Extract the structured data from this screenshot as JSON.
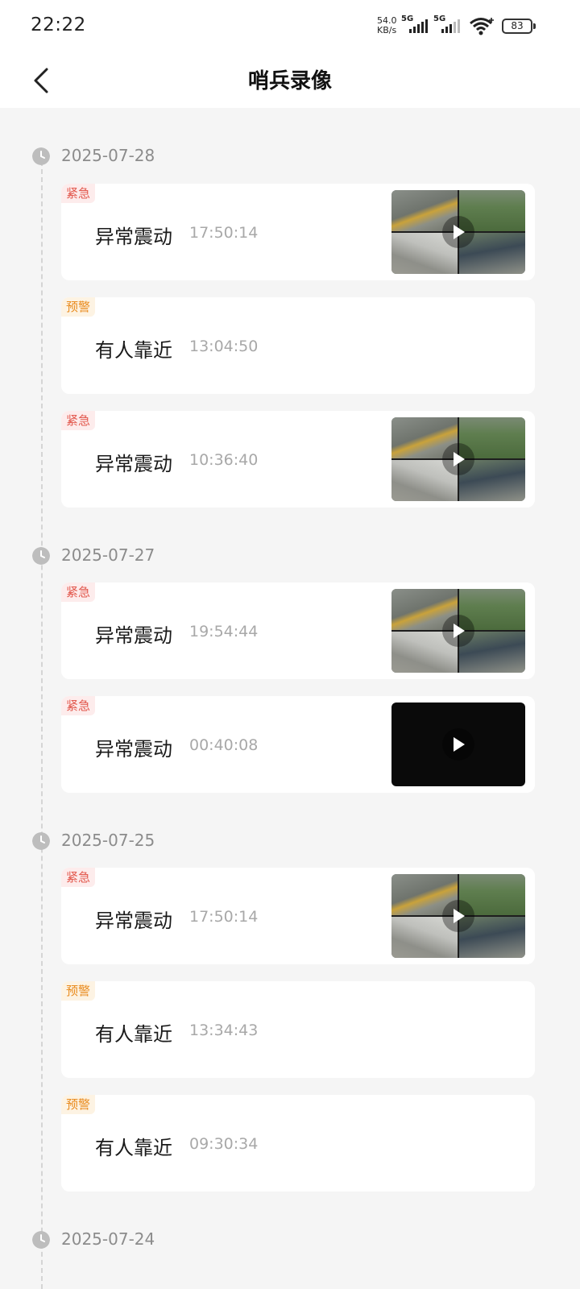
{
  "status_bar": {
    "time": "22:22",
    "net_speed_value": "54.0",
    "net_speed_unit": "KB/s",
    "sim1": "5G",
    "sim2": "5G",
    "battery": "83"
  },
  "header": {
    "title": "哨兵录像"
  },
  "groups": [
    {
      "date": "2025-07-28",
      "events": [
        {
          "tag": "紧急",
          "name": "异常震动",
          "time": "17:50:14"
        },
        {
          "tag": "预警",
          "name": "有人靠近",
          "time": "13:04:50"
        },
        {
          "tag": "紧急",
          "name": "异常震动",
          "time": "10:36:40"
        }
      ]
    },
    {
      "date": "2025-07-27",
      "events": [
        {
          "tag": "紧急",
          "name": "异常震动",
          "time": "19:54:44"
        },
        {
          "tag": "紧急",
          "name": "异常震动",
          "time": "00:40:08"
        }
      ]
    },
    {
      "date": "2025-07-25",
      "events": [
        {
          "tag": "紧急",
          "name": "异常震动",
          "time": "17:50:14"
        },
        {
          "tag": "预警",
          "name": "有人靠近",
          "time": "13:34:43"
        },
        {
          "tag": "预警",
          "name": "有人靠近",
          "time": "09:30:34"
        }
      ]
    },
    {
      "date": "2025-07-24",
      "events": []
    }
  ],
  "colors": {
    "urgent": "#e2574c",
    "warning": "#e98a1c",
    "background": "#f5f5f5"
  }
}
